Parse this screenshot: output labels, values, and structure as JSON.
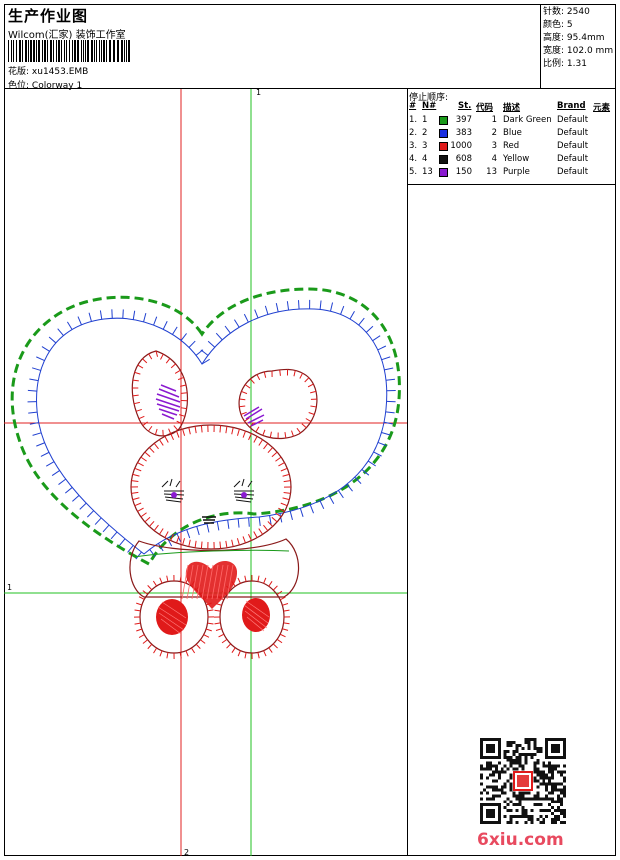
{
  "header": {
    "title": "生产作业图",
    "company": "Wilcom(汇家) 装饰工作室",
    "design_label": "花版:",
    "design_value": "xu1453.EMB",
    "colorway_label": "色位:",
    "colorway_value": "Colorway 1"
  },
  "stats": {
    "stitches_label": "针数:",
    "stitches_value": "2540",
    "colors_label": "颜色:",
    "colors_value": "5",
    "height_label": "高度:",
    "height_value": "95.4mm",
    "width_label": "宽度:",
    "width_value": "102.0 mm",
    "scale_label": "比例:",
    "scale_value": "1.31"
  },
  "stop_sequence": {
    "heading": "停止顺序:",
    "columns": [
      "#",
      "N#",
      "",
      "St.",
      "代码",
      "描述",
      "Brand",
      "元素"
    ],
    "rows": [
      {
        "idx": "1.",
        "n": "1",
        "color": "#1a9a1a",
        "st": "397",
        "code": "1",
        "desc": "Dark Green",
        "brand": "Default"
      },
      {
        "idx": "2.",
        "n": "2",
        "color": "#1a2fe0",
        "st": "383",
        "code": "2",
        "desc": "Blue",
        "brand": "Default"
      },
      {
        "idx": "3.",
        "n": "3",
        "color": "#e01a1a",
        "st": "1000",
        "code": "3",
        "desc": "Red",
        "brand": "Default"
      },
      {
        "idx": "4.",
        "n": "4",
        "color": "#111111",
        "st": "608",
        "code": "4",
        "desc": "Yellow",
        "brand": "Default"
      },
      {
        "idx": "5.",
        "n": "13",
        "color": "#8a1ad0",
        "st": "150",
        "code": "13",
        "desc": "Purple",
        "brand": "Default"
      }
    ]
  },
  "canvas": {
    "guide_labels": {
      "top_green": "1",
      "left_green": "1",
      "bottom_red": "2"
    },
    "colors": {
      "green": "#1aa01a",
      "blue": "#2040d0",
      "red": "#e01a1a",
      "dark_red": "#8a1a1a",
      "purple": "#8a1ad0",
      "guide_red": "#e02020",
      "guide_green": "#20c020"
    }
  },
  "watermark": "6xiu.com"
}
